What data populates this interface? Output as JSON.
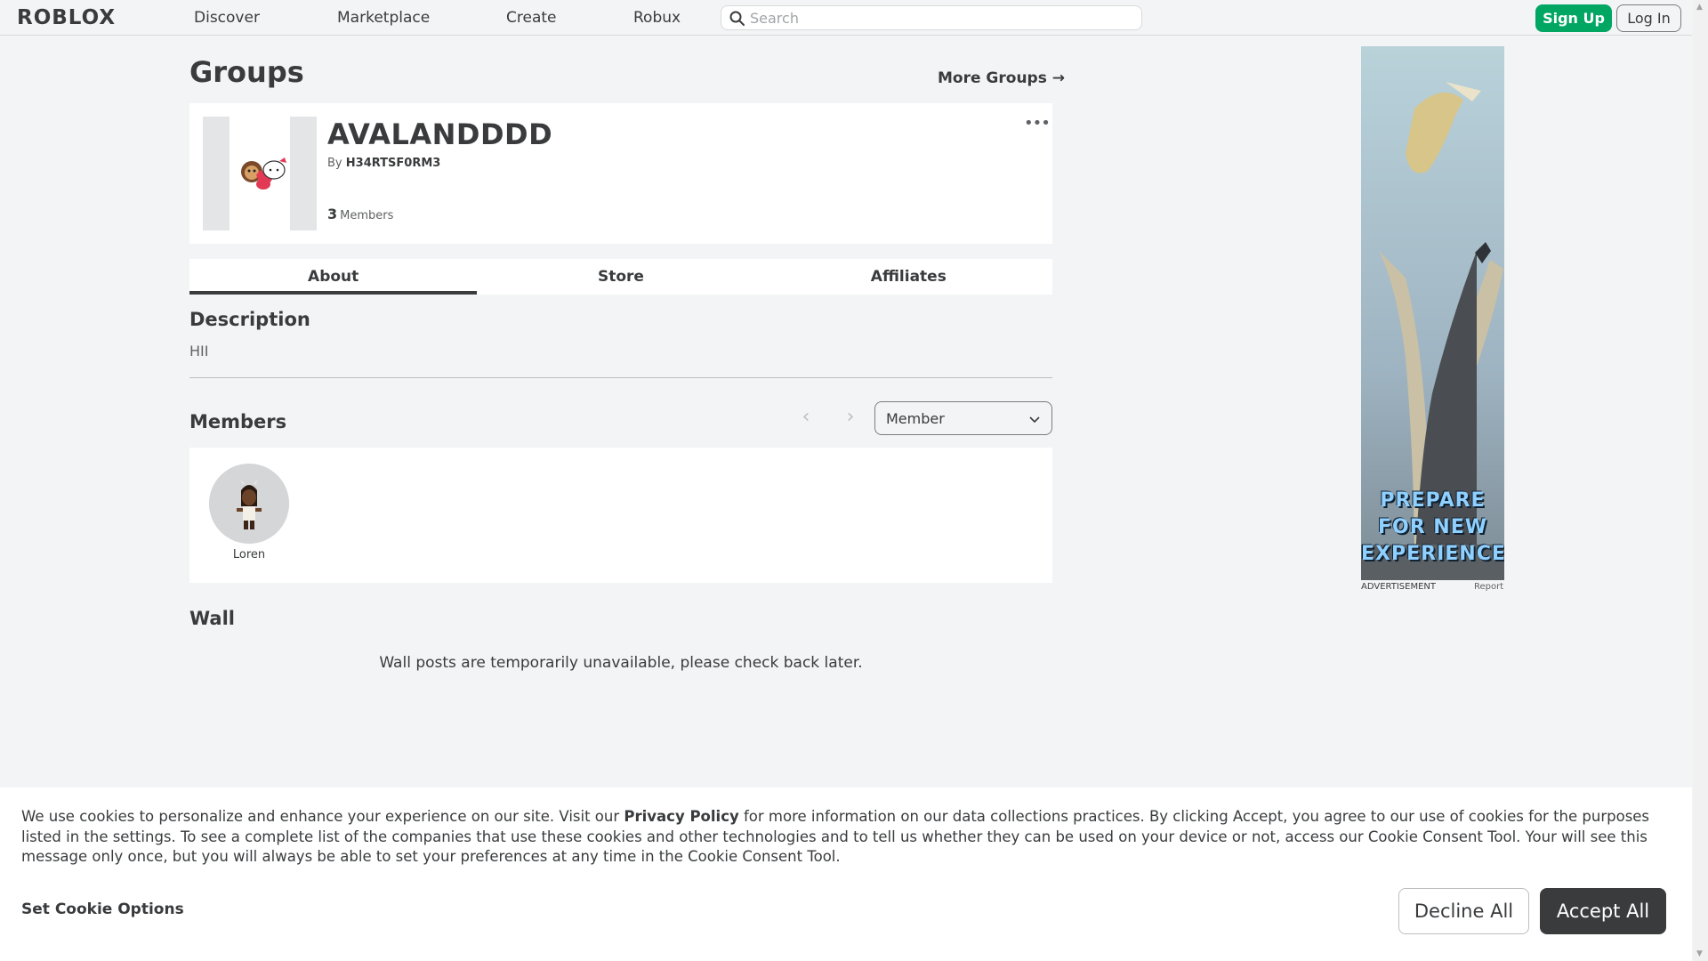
{
  "nav": {
    "logo": "ROBLOX",
    "links": [
      "Discover",
      "Marketplace",
      "Create",
      "Robux"
    ],
    "search_placeholder": "Search",
    "signup_label": "Sign Up",
    "login_label": "Log In"
  },
  "page": {
    "title": "Groups",
    "more_groups": "More Groups →"
  },
  "group": {
    "name": "AVALANDDDD",
    "by_prefix": "By",
    "owner": "H34RTSF0RM3",
    "member_count": "3",
    "members_label": "Members",
    "menu_icon": "more-dots-icon"
  },
  "tabs": [
    "About",
    "Store",
    "Affiliates"
  ],
  "about": {
    "description_heading": "Description",
    "description": "HII"
  },
  "members": {
    "heading": "Members",
    "role_selected": "Member",
    "list": [
      {
        "name": "Loren"
      }
    ]
  },
  "wall": {
    "heading": "Wall",
    "message": "Wall posts are temporarily unavailable, please check back later."
  },
  "ad": {
    "caption": "PREPARE FOR NEW EXPERIENCES",
    "label": "ADVERTISEMENT",
    "report": "Report"
  },
  "cookies": {
    "text_before": "We use cookies to personalize and enhance your experience on our site. Visit our ",
    "link": "Privacy Policy",
    "text_after": " for more information on our data collections practices. By clicking Accept, you agree to our use of cookies for the purposes listed in the settings. To see a complete list of the companies that use these cookies and other technologies and to tell us whether they can be used on your device or not, access our Cookie Consent Tool. Your will see this message only once, but you will always be able to set your preferences at any time in the Cookie Consent Tool.",
    "options_label": "Set Cookie Options",
    "decline_label": "Decline All",
    "accept_label": "Accept All"
  },
  "colors": {
    "accent_green": "#00a662",
    "text_dark": "#393b3d",
    "page_bg": "#f2f4f5"
  }
}
